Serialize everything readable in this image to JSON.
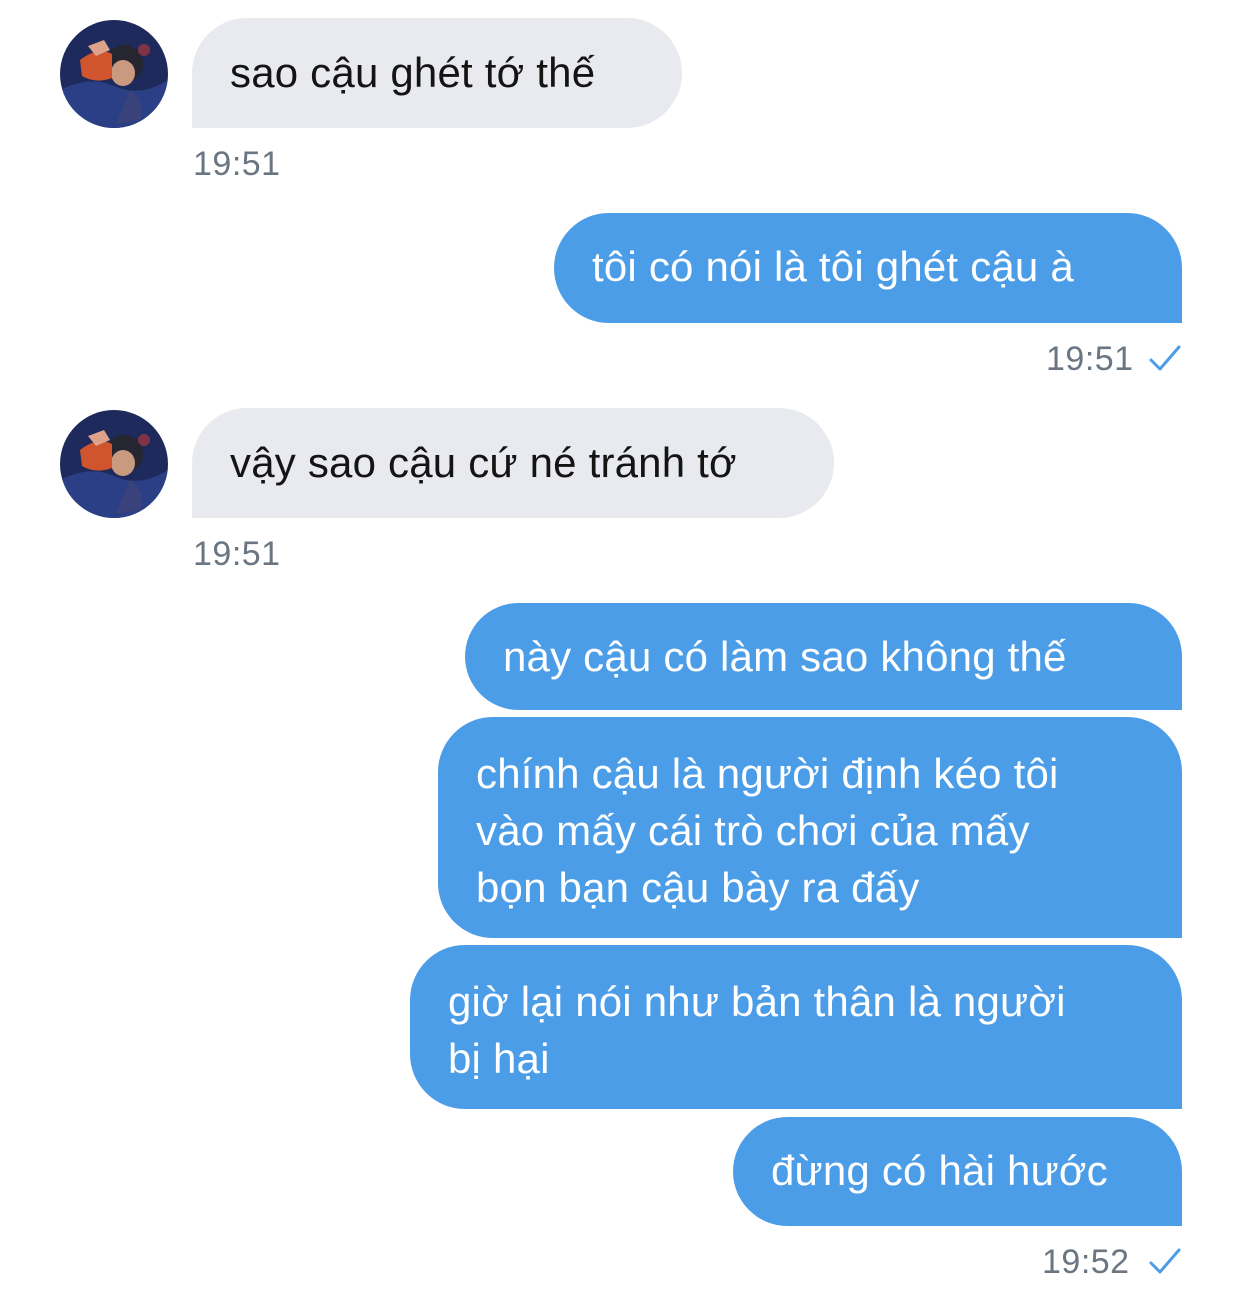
{
  "colors": {
    "incoming_bubble": "#e8eaef",
    "outgoing_bubble": "#4c9de8",
    "timestamp": "#6b7683",
    "read_check": "#4c9de8"
  },
  "contact": {
    "avatar_icon": "contact-avatar"
  },
  "messages": [
    {
      "direction": "incoming",
      "text": "sao cậu ghét tớ thế",
      "time": "19:51"
    },
    {
      "direction": "outgoing",
      "text": "tôi có nói là tôi ghét cậu à",
      "time": "19:51",
      "status_icon": "read-check-icon"
    },
    {
      "direction": "incoming",
      "text": "vậy sao cậu cứ né tránh tớ",
      "time": "19:51"
    },
    {
      "direction": "outgoing",
      "text": "này cậu có làm sao không thế"
    },
    {
      "direction": "outgoing",
      "lines": [
        "chính cậu là người định kéo tôi",
        "vào mấy cái trò chơi của mấy",
        "bọn bạn cậu bày ra đấy"
      ]
    },
    {
      "direction": "outgoing",
      "lines": [
        "giờ lại nói như bản thân là người",
        "bị hại"
      ]
    },
    {
      "direction": "outgoing",
      "text": "đừng có hài hước",
      "time": "19:52",
      "status_icon": "read-check-icon"
    }
  ]
}
